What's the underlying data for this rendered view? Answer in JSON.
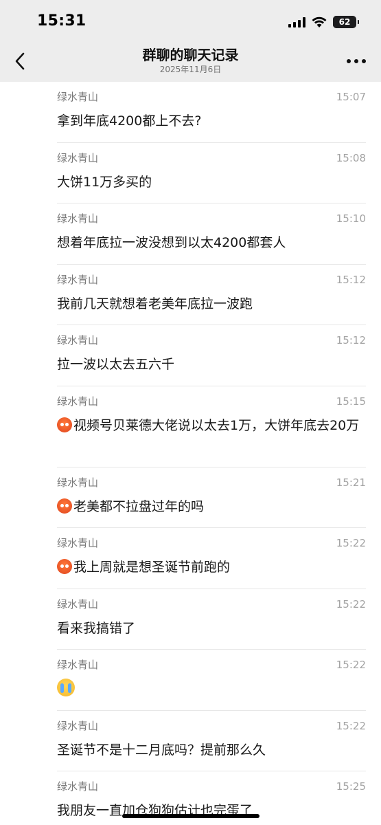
{
  "status_bar": {
    "time": "15:31",
    "battery": "62",
    "battery_level_percent": 62,
    "signal_bars": 4
  },
  "header": {
    "back_icon": "chevron-left-icon",
    "title": "群聊的聊天记录",
    "subtitle": "2025年11月6日",
    "more_icon": "ellipsis-icon"
  },
  "messages": [
    {
      "sender": "绿水青山",
      "time": "15:07",
      "text": "拿到年底4200都上不去?",
      "emoji": ""
    },
    {
      "sender": "绿水青山",
      "time": "15:08",
      "text": "大饼11万多买的",
      "emoji": ""
    },
    {
      "sender": "绿水青山",
      "time": "15:10",
      "text": "想着年底拉一波没想到以太4200都套人",
      "emoji": ""
    },
    {
      "sender": "绿水青山",
      "time": "15:12",
      "text": "我前几天就想着老美年底拉一波跑",
      "emoji": ""
    },
    {
      "sender": "绿水青山",
      "time": "15:12",
      "text": "拉一波以太去五六千",
      "emoji": ""
    },
    {
      "sender": "绿水青山",
      "time": "15:15",
      "text": "视频号贝莱德大佬说以太去1万，大饼年底去20万",
      "emoji": "angry-face"
    },
    {
      "sender": "绿水青山",
      "time": "15:21",
      "text": "老美都不拉盘过年的吗",
      "emoji": "angry-face"
    },
    {
      "sender": "绿水青山",
      "time": "15:22",
      "text": "我上周就是想圣诞节前跑的",
      "emoji": "angry-face"
    },
    {
      "sender": "绿水青山",
      "time": "15:22",
      "text": "看来我搞错了",
      "emoji": ""
    },
    {
      "sender": "绿水青山",
      "time": "15:22",
      "text": "",
      "emoji": "loudly-crying-face"
    },
    {
      "sender": "绿水青山",
      "time": "15:22",
      "text": "圣诞节不是十二月底吗？提前那么久",
      "emoji": ""
    },
    {
      "sender": "绿水青山",
      "time": "15:25",
      "text": "我朋友一直加仓狗狗估计也完蛋了",
      "emoji": ""
    }
  ],
  "colors": {
    "header_bg": "#ededed",
    "page_bg": "#ffffff",
    "sender": "#7a7a7a",
    "time": "#a3a3a3",
    "divider": "#e7e7e7"
  }
}
